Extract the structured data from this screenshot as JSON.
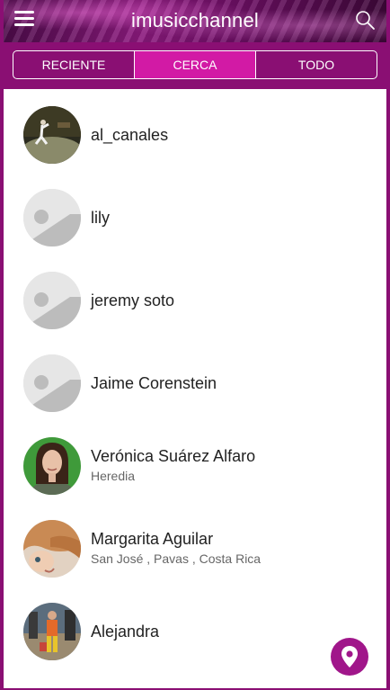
{
  "header": {
    "title": "imusicchannel",
    "menu_icon": "hamburger-menu-icon",
    "search_icon": "search-icon"
  },
  "tabs": [
    {
      "label": "RECIENTE",
      "active": false
    },
    {
      "label": "CERCA",
      "active": true
    },
    {
      "label": "TODO",
      "active": false
    }
  ],
  "users": [
    {
      "name": "al_canales",
      "location": "",
      "avatar": "photo"
    },
    {
      "name": "lily",
      "location": "",
      "avatar": "placeholder"
    },
    {
      "name": "jeremy soto",
      "location": "",
      "avatar": "placeholder"
    },
    {
      "name": "Jaime Corenstein",
      "location": "",
      "avatar": "placeholder"
    },
    {
      "name": "Verónica Suárez Alfaro",
      "location": "Heredia",
      "avatar": "photo"
    },
    {
      "name": "Margarita Aguilar",
      "location": "San José , Pavas , Costa Rica",
      "avatar": "photo"
    },
    {
      "name": "Alejandra",
      "location": "",
      "avatar": "photo"
    }
  ],
  "fab": {
    "icon": "location-pin-icon"
  },
  "colors": {
    "primary": "#8a0f73",
    "active_tab": "#d21aa5",
    "fab": "#a0168a"
  }
}
